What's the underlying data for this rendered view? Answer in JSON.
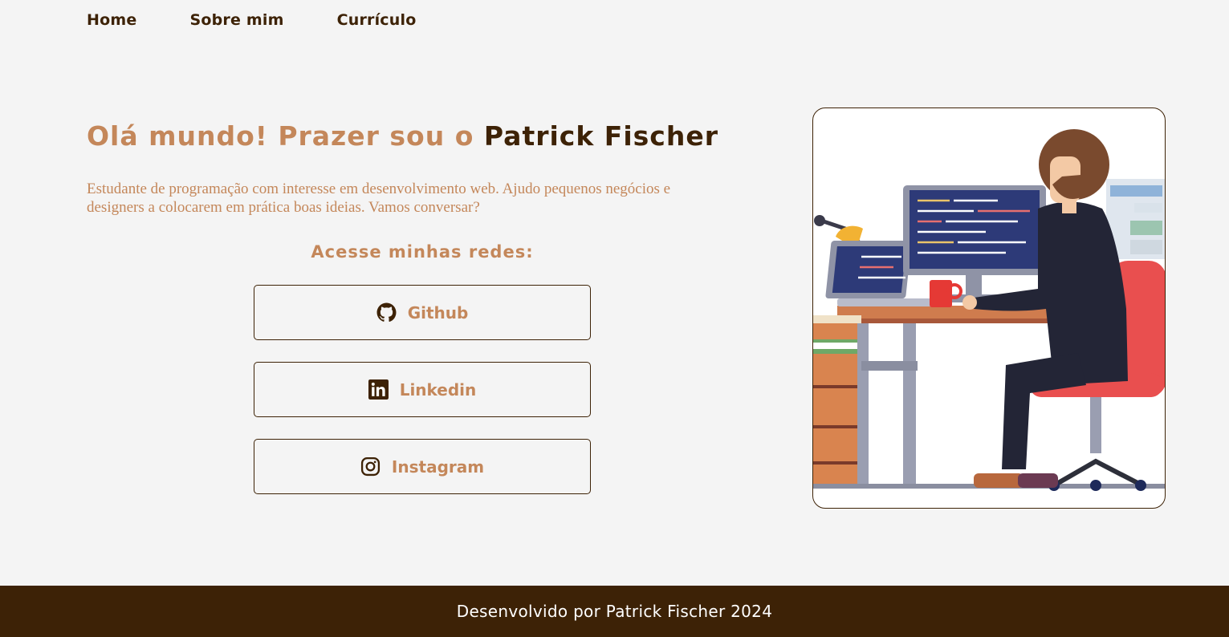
{
  "nav": {
    "items": [
      {
        "label": "Home"
      },
      {
        "label": "Sobre mim"
      },
      {
        "label": "Currículo"
      }
    ]
  },
  "hero": {
    "greeting": "Olá mundo! Prazer sou o ",
    "name": "Patrick Fischer",
    "description": "Estudante de programação com interesse em desenvolvimento web. Ajudo pequenos negócios e designers a colocarem em prática boas ideias. Vamos conversar?"
  },
  "social": {
    "heading": "Acesse minhas redes:",
    "links": [
      {
        "label": "Github",
        "icon": "github-icon"
      },
      {
        "label": "Linkedin",
        "icon": "linkedin-icon"
      },
      {
        "label": "Instagram",
        "icon": "instagram-icon"
      }
    ]
  },
  "illustration": {
    "subject": "programmer-at-desk-illustration"
  },
  "footer": {
    "text": "Desenvolvido por Patrick Fischer 2024"
  },
  "colors": {
    "accent": "#c4875a",
    "brand_dark": "#3d2206",
    "background": "#f4f4f4",
    "footer_text": "#ffffff"
  }
}
